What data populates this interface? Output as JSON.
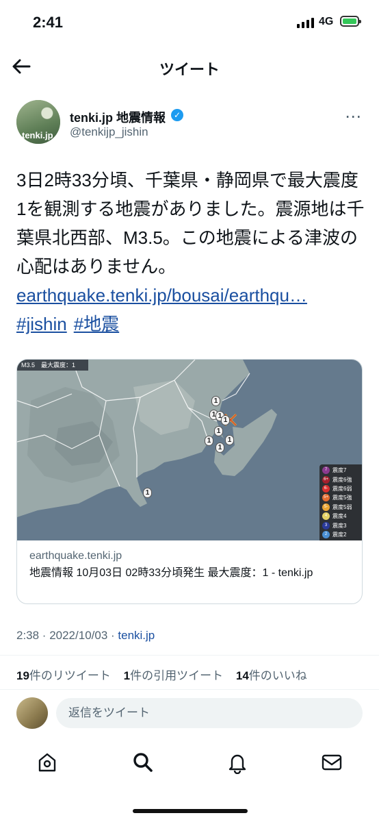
{
  "status_bar": {
    "time": "2:41",
    "network": "4G"
  },
  "header": {
    "title": "ツイート"
  },
  "author": {
    "display_name": "tenki.jp 地震情報",
    "handle": "@tenkijp_jishin",
    "avatar_text": "tenki.jp"
  },
  "tweet": {
    "body": "3日2時33分頃、千葉県・静岡県で最大震度1を観測する地震がありました。震源地は千葉県北西部、M3.5。この地震による津波の心配はありません。",
    "link": "earthquake.tenki.jp/bousai/earthqu…",
    "hashtags": [
      "#jishin",
      "#地震"
    ]
  },
  "card": {
    "map_label": "M3.5　最大震度：1",
    "domain": "earthquake.tenki.jp",
    "title": "地震情報 10月03日 02時33分頃発生 最大震度：1 - tenki.jp",
    "intensity_markers": [
      "1",
      "1",
      "1",
      "1",
      "1",
      "1",
      "1",
      "1",
      "1"
    ],
    "legend": [
      {
        "badge": "7",
        "label": "震度7",
        "color": "#8b3a8f"
      },
      {
        "badge": "6+",
        "label": "震度6強",
        "color": "#a3202d"
      },
      {
        "badge": "6-",
        "label": "震度6弱",
        "color": "#d9302f"
      },
      {
        "badge": "5+",
        "label": "震度5強",
        "color": "#e36c2f"
      },
      {
        "badge": "5-",
        "label": "震度5弱",
        "color": "#e9a534"
      },
      {
        "badge": "4",
        "label": "震度4",
        "color": "#e4d266"
      },
      {
        "badge": "3",
        "label": "震度3",
        "color": "#2a3a9a"
      },
      {
        "badge": "2",
        "label": "震度2",
        "color": "#4a8fd4"
      }
    ]
  },
  "timestamp": {
    "time": "2:38 · 2022/10/03 · ",
    "source": "tenki.jp"
  },
  "stats": {
    "retweets_count": "19",
    "retweets_label": "件のリツイート",
    "quotes_count": "1",
    "quotes_label": "件の引用ツイート",
    "likes_count": "14",
    "likes_label": "件のいいね"
  },
  "reply": {
    "placeholder": "返信をツイート"
  },
  "tab_bar": {
    "icons": [
      "home-icon",
      "search-icon",
      "notifications-icon",
      "messages-icon"
    ]
  }
}
